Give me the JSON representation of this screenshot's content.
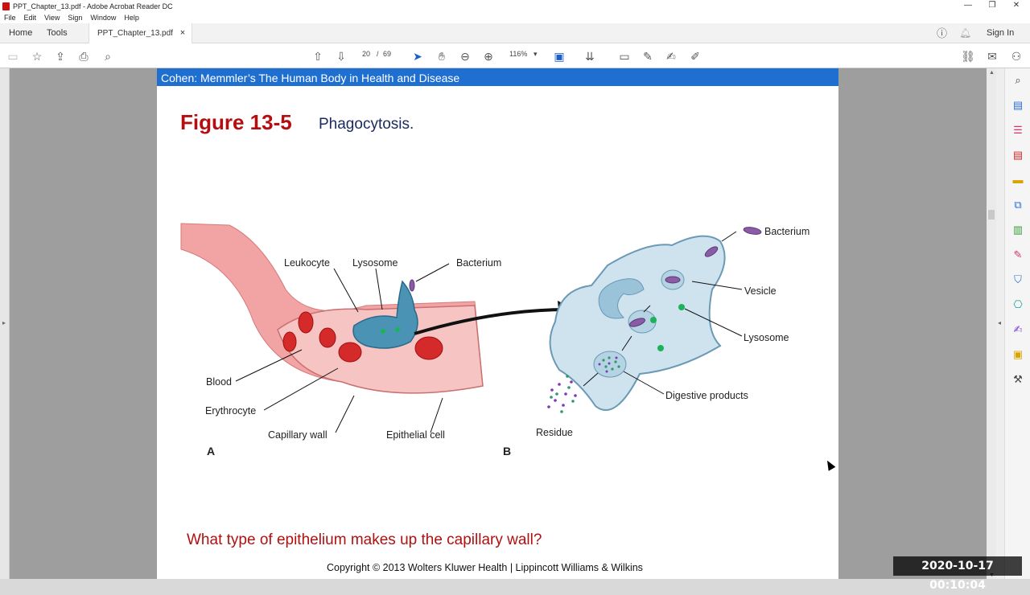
{
  "window": {
    "title": "PPT_Chapter_13.pdf - Adobe Acrobat Reader DC",
    "minimize": "—",
    "restore": "❐",
    "close": "✕"
  },
  "menu": [
    "File",
    "Edit",
    "View",
    "Sign",
    "Window",
    "Help"
  ],
  "tabs": {
    "home": "Home",
    "tools": "Tools",
    "document": "PPT_Chapter_13.pdf",
    "close": "×",
    "sign_in": "Sign In"
  },
  "toolbar": {
    "current_page": "20",
    "page_separator": "/",
    "total_pages": "69",
    "zoom": "116%"
  },
  "page": {
    "banner": "Cohen: Memmler’s The Human Body in Health and Disease",
    "figure_label": "Figure 13-5",
    "figure_caption": "Phagocytosis.",
    "question": "What type of epithelium makes up the capillary wall?",
    "copyright": "Copyright © 2013 Wolters Kluwer Health | Lippincott Williams & Wilkins"
  },
  "figure": {
    "labels_a": {
      "leukocyte": "Leukocyte",
      "lysosome": "Lysosome",
      "bacterium": "Bacterium",
      "blood": "Blood",
      "erythrocyte": "Erythrocyte",
      "capillary_wall": "Capillary wall",
      "epithelial_cell": "Epithelial cell",
      "panel": "A"
    },
    "labels_b": {
      "bacterium": "Bacterium",
      "vesicle": "Vesicle",
      "lysosome": "Lysosome",
      "digestive_products": "Digestive products",
      "residue": "Residue",
      "panel": "B"
    }
  },
  "timestamp": "2020-10-17 00:10:04",
  "colors": {
    "banner": "#1f6fd1",
    "figure_title": "#b50d10",
    "question": "#b01010"
  }
}
